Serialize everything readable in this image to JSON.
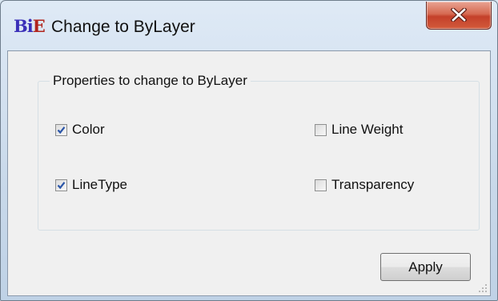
{
  "window": {
    "title": "Change to ByLayer",
    "app_icon": {
      "name": "bie-logo-icon",
      "text_b": "Bi",
      "text_e": "E"
    },
    "close_icon": "close-icon"
  },
  "group": {
    "legend": "Properties to change to ByLayer",
    "checkboxes": [
      {
        "label": "Color",
        "checked": true
      },
      {
        "label": "Line Weight",
        "checked": false
      },
      {
        "label": "LineType",
        "checked": true
      },
      {
        "label": "Transparency",
        "checked": false
      }
    ]
  },
  "buttons": {
    "apply_label": "Apply"
  },
  "colors": {
    "close_button": "#c4402a",
    "check_mark": "#2a55a8",
    "app_icon_b": "#3a2fb8",
    "app_icon_e": "#b1241c"
  }
}
